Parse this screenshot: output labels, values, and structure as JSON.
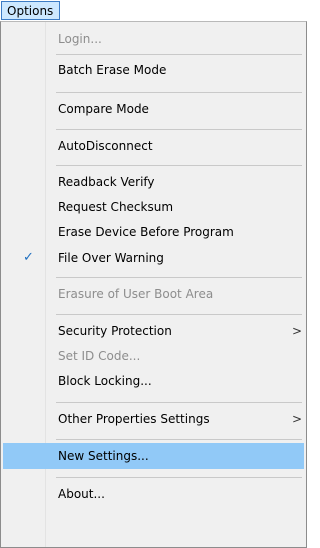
{
  "menubar": {
    "label": "Options"
  },
  "menu": {
    "items": [
      {
        "label": "Login..."
      },
      {
        "label": "Batch Erase Mode"
      },
      {
        "label": "Compare Mode"
      },
      {
        "label": "AutoDisconnect"
      },
      {
        "label": "Readback Verify"
      },
      {
        "label": "Request Checksum"
      },
      {
        "label": "Erase Device Before Program"
      },
      {
        "label": "File Over Warning",
        "checked": true
      },
      {
        "label": "Erasure of User Boot Area"
      },
      {
        "label": "Security Protection",
        "submenu": true
      },
      {
        "label": "Set ID Code..."
      },
      {
        "label": "Block Locking..."
      },
      {
        "label": "Other Properties Settings",
        "submenu": true
      },
      {
        "label": "New Settings...",
        "highlighted": true
      },
      {
        "label": "About..."
      }
    ],
    "check_glyph": "✓",
    "submenu_glyph": ">"
  },
  "colors": {
    "highlight": "#91c9f7",
    "check": "#1f6fbf",
    "disabled_text": "#8d8d8d"
  }
}
